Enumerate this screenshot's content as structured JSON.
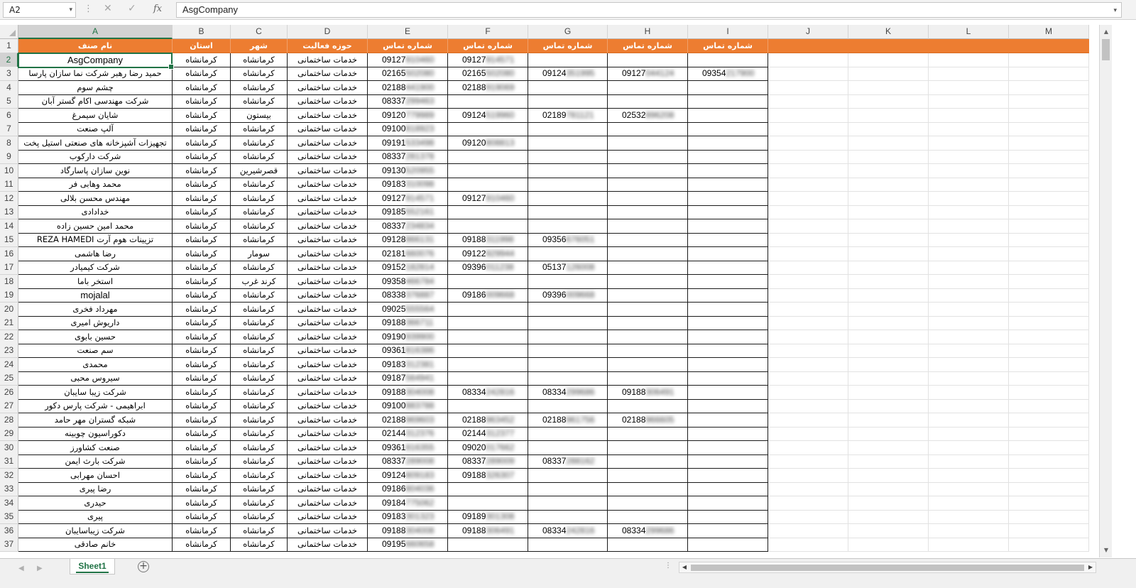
{
  "formula_bar": {
    "name_box": "A2",
    "name_box_arrow": "▾",
    "separator": "⋮",
    "cancel_icon": "✕",
    "enter_icon": "✓",
    "fx_label": "fx",
    "content": "AsgCompany",
    "expand_icon": "▾"
  },
  "columns": [
    "A",
    "B",
    "C",
    "D",
    "E",
    "F",
    "G",
    "H",
    "I",
    "J",
    "K",
    "L",
    "M"
  ],
  "header": {
    "row_number": "1",
    "cells": [
      "نام صنف",
      "استان",
      "شهر",
      "حوزه فعالیت",
      "شماره تماس",
      "شماره تماس",
      "شماره تماس",
      "شماره تماس",
      "شماره تماس"
    ]
  },
  "rows": [
    {
      "n": "2",
      "name": "AsgCompany",
      "province": "کرمانشاه",
      "city": "کرمانشاه",
      "field": "خدمات ساختمانی",
      "p1": "09127910460",
      "p2": "09127914571",
      "p3": "",
      "p4": "",
      "p5": ""
    },
    {
      "n": "3",
      "name": "حمید رضا رهبر شرکت نما سازان پارسا",
      "province": "کرمانشاه",
      "city": "کرمانشاه",
      "field": "خدمات ساختمانی",
      "p1": "02165502080",
      "p2": "02165502080",
      "p3": "09124351995",
      "p4": "09127044124",
      "p5": "09354217900"
    },
    {
      "n": "4",
      "name": "چشم سوم",
      "province": "کرمانشاه",
      "city": "کرمانشاه",
      "field": "خدمات ساختمانی",
      "p1": "02188441900",
      "p2": "02188919069",
      "p3": "",
      "p4": "",
      "p5": ""
    },
    {
      "n": "5",
      "name": "شرکت مهندسی اکام گستر آبان",
      "province": "کرمانشاه",
      "city": "کرمانشاه",
      "field": "خدمات ساختمانی",
      "p1": "08337299463",
      "p2": "",
      "p3": "",
      "p4": "",
      "p5": ""
    },
    {
      "n": "6",
      "name": "شایان سیمرغ",
      "province": "کرمانشاه",
      "city": "بیستون",
      "field": "خدمات ساختمانی",
      "p1": "09120779989",
      "p2": "09124519960",
      "p3": "02189781121",
      "p4": "02532896208",
      "p5": ""
    },
    {
      "n": "7",
      "name": "آلپ صنعت",
      "province": "کرمانشاه",
      "city": "کرمانشاه",
      "field": "خدمات ساختمانی",
      "p1": "09100818923",
      "p2": "",
      "p3": "",
      "p4": "",
      "p5": ""
    },
    {
      "n": "8",
      "name": "تجهیزات آشپزخانه های صنعتی استیل پخت",
      "province": "کرمانشاه",
      "city": "کرمانشاه",
      "field": "خدمات ساختمانی",
      "p1": "09191533498",
      "p2": "09120808813",
      "p3": "",
      "p4": "",
      "p5": ""
    },
    {
      "n": "9",
      "name": "شرکت دارکوب",
      "province": "کرمانشاه",
      "city": "کرمانشاه",
      "field": "خدمات ساختمانی",
      "p1": "08337281378",
      "p2": "",
      "p3": "",
      "p4": "",
      "p5": ""
    },
    {
      "n": "10",
      "name": "نوین سازان پاسارگاد",
      "province": "کرمانشاه",
      "city": "قصرشیرین",
      "field": "خدمات ساختمانی",
      "p1": "09130520955",
      "p2": "",
      "p3": "",
      "p4": "",
      "p5": ""
    },
    {
      "n": "11",
      "name": "محمد وهابی فر",
      "province": "کرمانشاه",
      "city": "کرمانشاه",
      "field": "خدمات ساختمانی",
      "p1": "09183310098",
      "p2": "",
      "p3": "",
      "p4": "",
      "p5": ""
    },
    {
      "n": "12",
      "name": "مهندس محسن بلالی",
      "province": "کرمانشاه",
      "city": "کرمانشاه",
      "field": "خدمات ساختمانی",
      "p1": "09127914571",
      "p2": "09127910460",
      "p3": "",
      "p4": "",
      "p5": ""
    },
    {
      "n": "13",
      "name": "خدادادی",
      "province": "کرمانشاه",
      "city": "کرمانشاه",
      "field": "خدمات ساختمانی",
      "p1": "09185552161",
      "p2": "",
      "p3": "",
      "p4": "",
      "p5": ""
    },
    {
      "n": "14",
      "name": "محمد امین حسین زاده",
      "province": "کرمانشاه",
      "city": "کرمانشاه",
      "field": "خدمات ساختمانی",
      "p1": "08337234834",
      "p2": "",
      "p3": "",
      "p4": "",
      "p5": ""
    },
    {
      "n": "15",
      "name": "تزیینات هوم آرت REZA HAMEDI",
      "province": "کرمانشاه",
      "city": "کرمانشاه",
      "field": "خدمات ساختمانی",
      "p1": "09128866131",
      "p2": "09188311998",
      "p3": "09356676051",
      "p4": "",
      "p5": ""
    },
    {
      "n": "16",
      "name": "رضا هاشمی",
      "province": "کرمانشاه",
      "city": "سومار",
      "field": "خدمات ساختمانی",
      "p1": "02181660076",
      "p2": "09122929944",
      "p3": "",
      "p4": "",
      "p5": ""
    },
    {
      "n": "17",
      "name": "شرکت کیمیادر",
      "province": "کرمانشاه",
      "city": "کرمانشاه",
      "field": "خدمات ساختمانی",
      "p1": "09152182814",
      "p2": "09396011238",
      "p3": "05137126008",
      "p4": "",
      "p5": ""
    },
    {
      "n": "18",
      "name": "استخر باما",
      "province": "کرمانشاه",
      "city": "کرند غرب",
      "field": "خدمات ساختمانی",
      "p1": "09358466784",
      "p2": "",
      "p3": "",
      "p4": "",
      "p5": ""
    },
    {
      "n": "19",
      "name": "mojalal",
      "province": "کرمانشاه",
      "city": "کرمانشاه",
      "field": "خدمات ساختمانی",
      "p1": "08338376887",
      "p2": "09186009668",
      "p3": "09396009668",
      "p4": "",
      "p5": ""
    },
    {
      "n": "20",
      "name": "مهرداد فخری",
      "province": "کرمانشاه",
      "city": "کرمانشاه",
      "field": "خدمات ساختمانی",
      "p1": "09025555564",
      "p2": "",
      "p3": "",
      "p4": "",
      "p5": ""
    },
    {
      "n": "21",
      "name": "داریوش امیری",
      "province": "کرمانشاه",
      "city": "کرمانشاه",
      "field": "خدمات ساختمانی",
      "p1": "09188366711",
      "p2": "",
      "p3": "",
      "p4": "",
      "p5": ""
    },
    {
      "n": "22",
      "name": "حسین بابوی",
      "province": "کرمانشاه",
      "city": "کرمانشاه",
      "field": "خدمات ساختمانی",
      "p1": "09190939900",
      "p2": "",
      "p3": "",
      "p4": "",
      "p5": ""
    },
    {
      "n": "23",
      "name": "سم صنعت",
      "province": "کرمانشاه",
      "city": "کرمانشاه",
      "field": "خدمات ساختمانی",
      "p1": "09361816386",
      "p2": "",
      "p3": "",
      "p4": "",
      "p5": ""
    },
    {
      "n": "24",
      "name": "محمدی",
      "province": "کرمانشاه",
      "city": "کرمانشاه",
      "field": "خدمات ساختمانی",
      "p1": "09183312381",
      "p2": "",
      "p3": "",
      "p4": "",
      "p5": ""
    },
    {
      "n": "25",
      "name": "سیروس محبی",
      "province": "کرمانشاه",
      "city": "کرمانشاه",
      "field": "خدمات ساختمانی",
      "p1": "09187564941",
      "p2": "",
      "p3": "",
      "p4": "",
      "p5": ""
    },
    {
      "n": "26",
      "name": "شرکت زیبا سایبان",
      "province": "کرمانشاه",
      "city": "کرمانشاه",
      "field": "خدمات ساختمانی",
      "p1": "09188304008",
      "p2": "08334242816",
      "p3": "08334299686",
      "p4": "09188306491",
      "p5": ""
    },
    {
      "n": "27",
      "name": "ابراهیمی - شرکت پارس دکور",
      "province": "کرمانشاه",
      "city": "کرمانشاه",
      "field": "خدمات ساختمانی",
      "p1": "09100883788",
      "p2": "",
      "p3": "",
      "p4": "",
      "p5": ""
    },
    {
      "n": "28",
      "name": "شبکه گستران مهر حامد",
      "province": "کرمانشاه",
      "city": "کرمانشاه",
      "field": "خدمات ساختمانی",
      "p1": "02188969603",
      "p2": "02188963452",
      "p3": "02188961756",
      "p4": "02188966605",
      "p5": ""
    },
    {
      "n": "29",
      "name": "دکوراسیون چوبینه",
      "province": "کرمانشاه",
      "city": "کرمانشاه",
      "field": "خدمات ساختمانی",
      "p1": "02144312376",
      "p2": "02144312377",
      "p3": "",
      "p4": "",
      "p5": ""
    },
    {
      "n": "30",
      "name": "صنعت کشاورز",
      "province": "کرمانشاه",
      "city": "کرمانشاه",
      "field": "خدمات ساختمانی",
      "p1": "09361816355",
      "p2": "09020017662",
      "p3": "",
      "p4": "",
      "p5": ""
    },
    {
      "n": "31",
      "name": "شرکت بارث ایمن",
      "province": "کرمانشاه",
      "city": "کرمانشاه",
      "field": "خدمات ساختمانی",
      "p1": "08337289008",
      "p2": "08337289009",
      "p3": "08337288162",
      "p4": "",
      "p5": ""
    },
    {
      "n": "32",
      "name": "احسان مهرابی",
      "province": "کرمانشاه",
      "city": "کرمانشاه",
      "field": "خدمات ساختمانی",
      "p1": "09124809183",
      "p2": "09188326307",
      "p3": "",
      "p4": "",
      "p5": ""
    },
    {
      "n": "33",
      "name": "رضا پیری",
      "province": "کرمانشاه",
      "city": "کرمانشاه",
      "field": "خدمات ساختمانی",
      "p1": "09186804036",
      "p2": "",
      "p3": "",
      "p4": "",
      "p5": ""
    },
    {
      "n": "34",
      "name": "حیدری",
      "province": "کرمانشاه",
      "city": "کرمانشاه",
      "field": "خدمات ساختمانی",
      "p1": "09184775062",
      "p2": "",
      "p3": "",
      "p4": "",
      "p5": ""
    },
    {
      "n": "35",
      "name": "پیری",
      "province": "کرمانشاه",
      "city": "کرمانشاه",
      "field": "خدمات ساختمانی",
      "p1": "09183301323",
      "p2": "09189301308",
      "p3": "",
      "p4": "",
      "p5": ""
    },
    {
      "n": "36",
      "name": "شرکت زیباسایبان",
      "province": "کرمانشاه",
      "city": "کرمانشاه",
      "field": "خدمات ساختمانی",
      "p1": "09188304008",
      "p2": "09188306491",
      "p3": "08334242816",
      "p4": "08334299686",
      "p5": ""
    },
    {
      "n": "37",
      "name": "خانم صادقی",
      "province": "کرمانشاه",
      "city": "کرمانشاه",
      "field": "خدمات ساختمانی",
      "p1": "09195660658",
      "p2": "",
      "p3": "",
      "p4": "",
      "p5": ""
    }
  ],
  "sheet_tabs": [
    "Sheet1"
  ],
  "add_sheet_label": "+",
  "nav": {
    "prev": "◀",
    "next": "▶"
  },
  "scroll": {
    "up": "▲",
    "down": "▼",
    "left": "◀",
    "right": "▶",
    "dots": "⋮"
  },
  "colors": {
    "header_orange": "#ed7d31",
    "excel_green": "#217346"
  }
}
